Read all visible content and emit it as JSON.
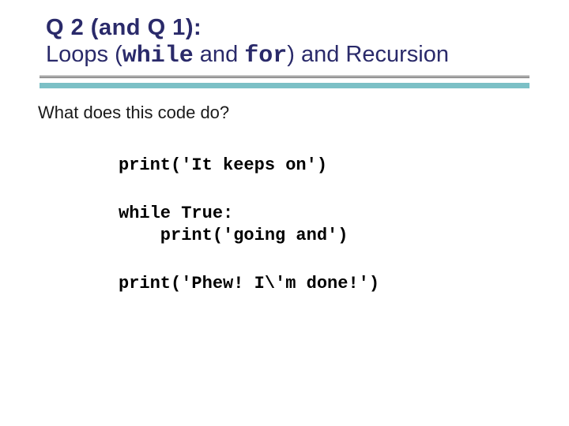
{
  "title": {
    "line1_a": "Q 2 (and Q 1)",
    "line1_b": ":",
    "line2_a": "Loops (",
    "line2_while": "while",
    "line2_b": " and ",
    "line2_for": "for",
    "line2_c": ") and Recursion"
  },
  "question": "What does this code do?",
  "code": {
    "l1": "print('It keeps on')",
    "l2": "while True:",
    "l3": "    print('going and')",
    "l4": "print('Phew! I\\'m done!')"
  }
}
